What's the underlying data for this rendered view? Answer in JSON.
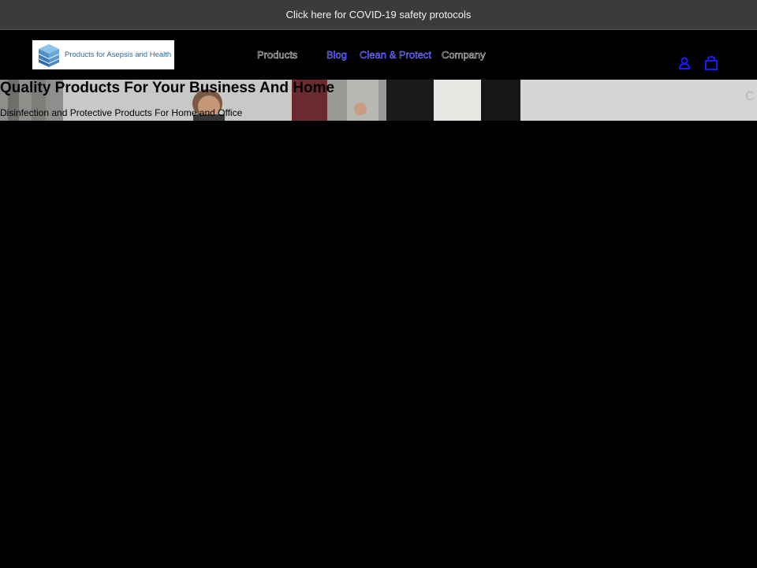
{
  "announcement": {
    "text": "Click here for COVID-19 safety protocols"
  },
  "header": {
    "logo_text": "Products for Asepsis and Health",
    "nav": [
      {
        "label": "Products"
      },
      {
        "label": "Blog"
      },
      {
        "label": "Clean & Protect"
      },
      {
        "label": "Company"
      }
    ],
    "icons": [
      "account-icon",
      "cart-icon"
    ]
  },
  "hero": {
    "title": "Quality Products For Your Business And Home",
    "subtitle": "Disinfection and Protective Products For Home and Office"
  },
  "colors": {
    "announcement_bg": "#3b3b3b",
    "page_bg": "#000000",
    "link_blue": "#1a1aff",
    "logo_blue": "#2f6aa3"
  }
}
